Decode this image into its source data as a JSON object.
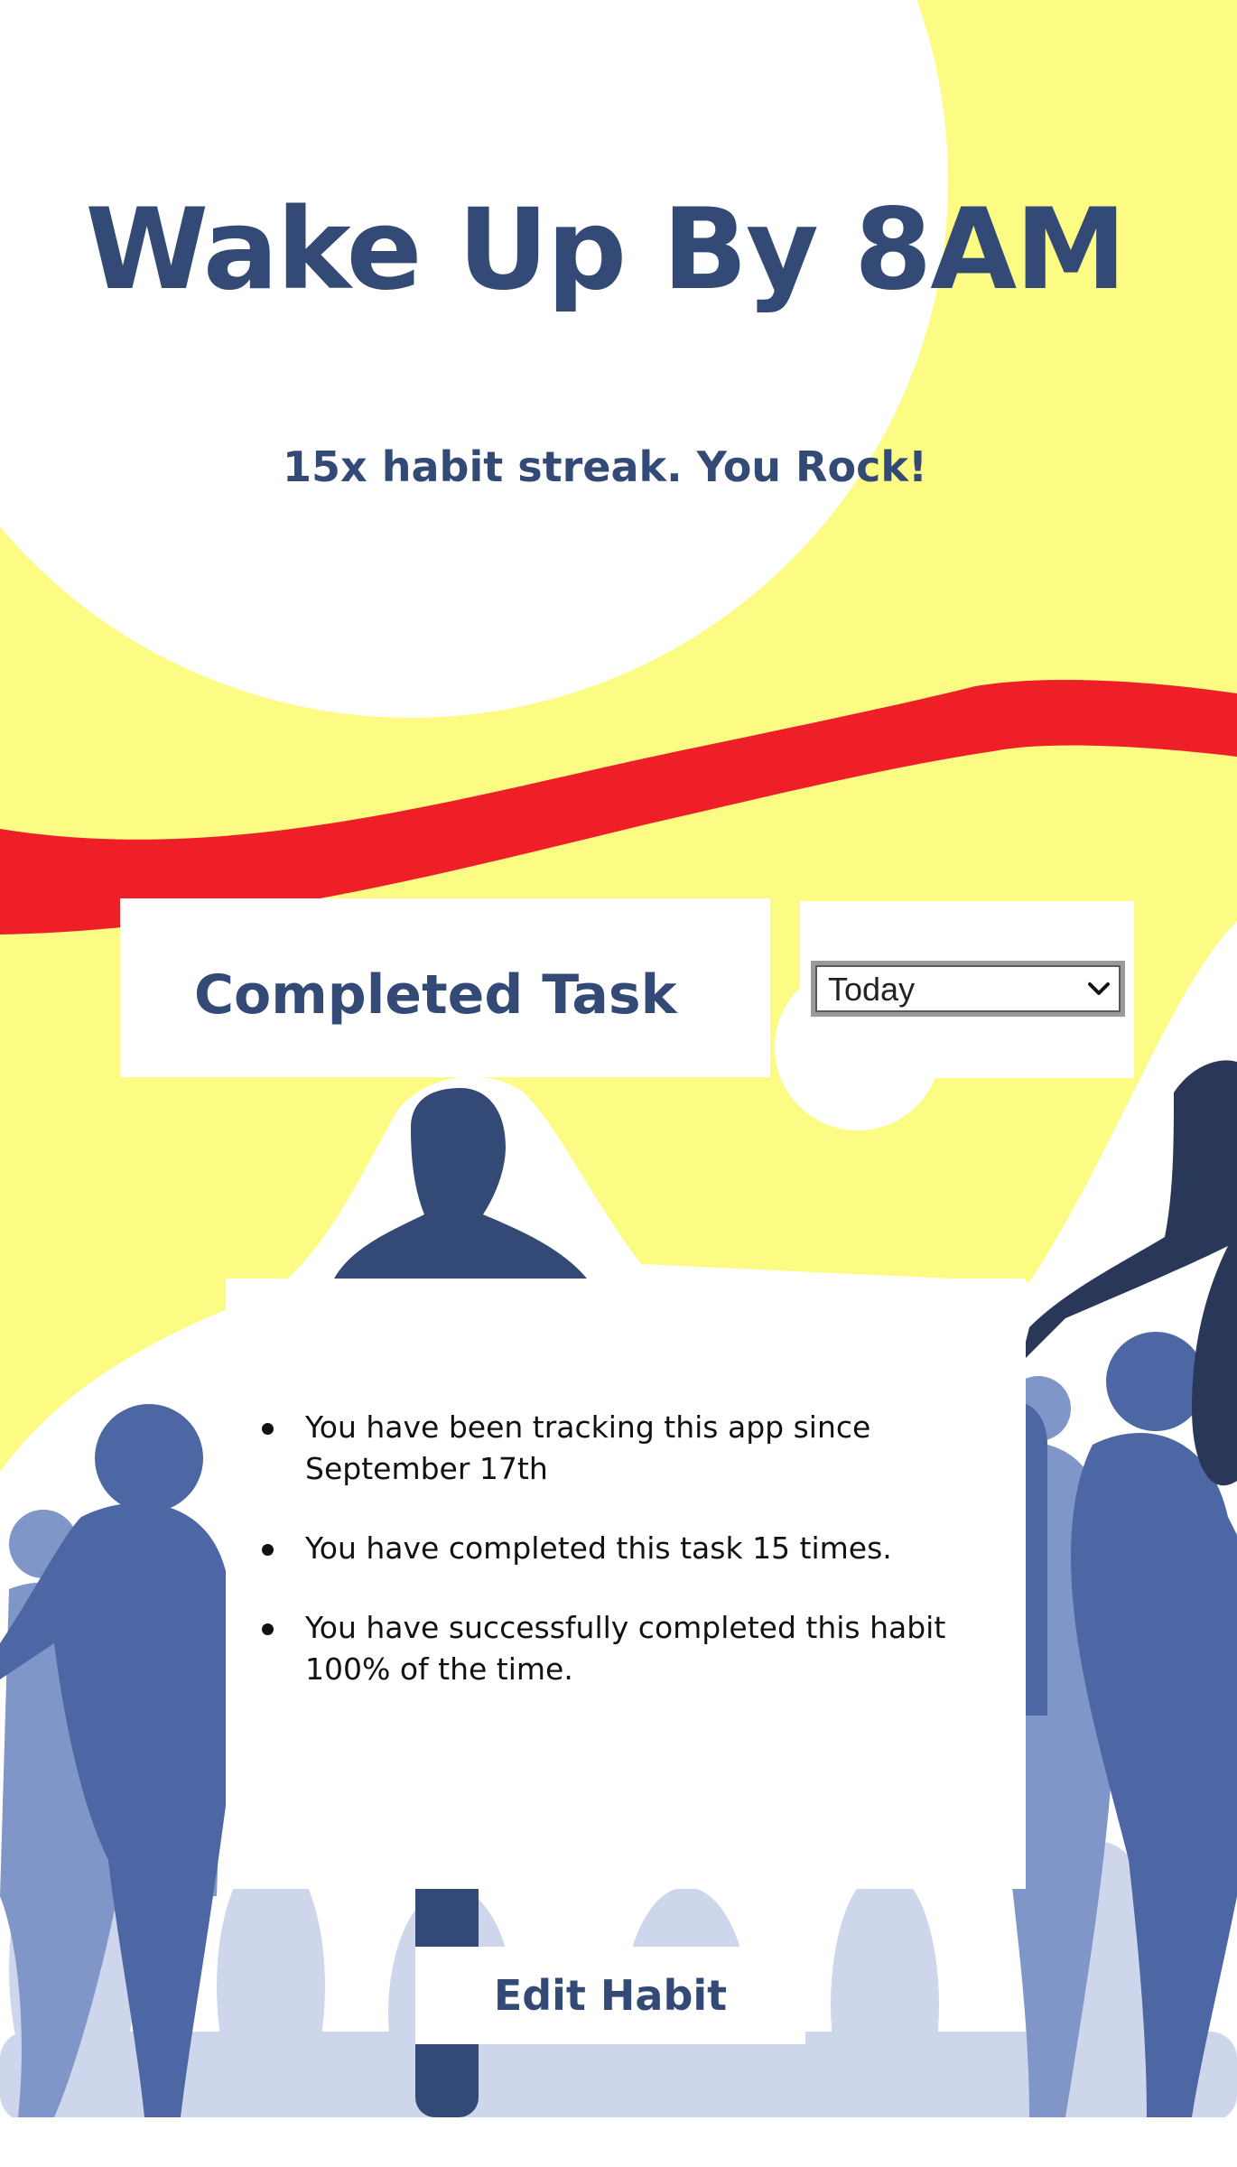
{
  "habit": {
    "title": "Wake Up By 8AM",
    "streak_message": "15x habit streak.  You Rock!"
  },
  "completed": {
    "label": "Completed Task",
    "filter_selected": "Today"
  },
  "stats": {
    "items": [
      "You have been tracking this app since September 17th",
      "You have completed this task 15 times.",
      "You have successfully completed this habit 100% of the time."
    ]
  },
  "actions": {
    "edit_label": "Edit Habit"
  },
  "colors": {
    "background_yellow": "#fcfc84",
    "ribbon_red": "#ee1f26",
    "text_navy": "#344a76",
    "runner_dark": "#344a76",
    "runner_mid": "#5470b0",
    "runner_light": "#8095c8",
    "runner_faint": "#cdd6ea"
  }
}
